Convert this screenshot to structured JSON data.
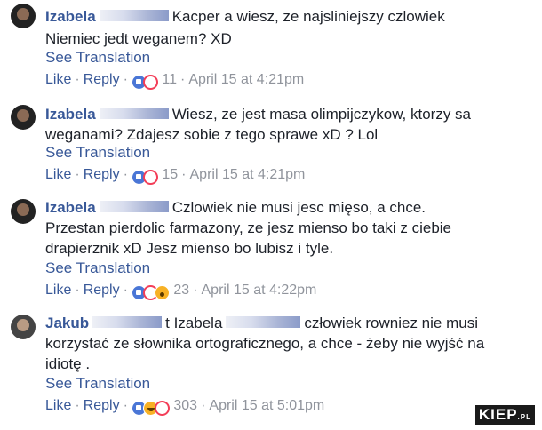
{
  "comments": [
    {
      "author": "Izabela",
      "lines": [
        "Kacper a wiesz, ze najsliniejszy czlowiek",
        "Niemiec jedt weganem? XD"
      ],
      "see_translation": "See Translation",
      "like": "Like",
      "reply": "Reply",
      "reaction_icons": [
        "like-icon",
        "love-icon"
      ],
      "reaction_count": "11",
      "timestamp": "April 15 at 4:21pm"
    },
    {
      "author": "Izabela",
      "lines": [
        "Wiesz, ze jest masa olimpijczykow, ktorzy sa",
        "weganami? Zdajesz sobie z tego sprawe xD ? Lol"
      ],
      "see_translation": "See Translation",
      "like": "Like",
      "reply": "Reply",
      "reaction_icons": [
        "like-icon",
        "love-icon"
      ],
      "reaction_count": "15",
      "timestamp": "April 15 at 4:21pm"
    },
    {
      "author": "Izabela",
      "lines": [
        "Czlowiek nie musi jesc mięso, a chce.",
        "Przestan pierdolic farmazony, ze jesz mienso bo taki z ciebie",
        "drapierznik xD Jesz mienso bo lubisz i tyle."
      ],
      "see_translation": "See Translation",
      "like": "Like",
      "reply": "Reply",
      "reaction_icons": [
        "like-icon",
        "love-icon",
        "wow-icon"
      ],
      "reaction_count": "23",
      "timestamp": "April 15 at 4:22pm"
    },
    {
      "author": "Jakub",
      "mention": "t Izabela",
      "lines": [
        "człowiek rowniez nie musi",
        "korzystać ze słownika ortograficznego, a chce - żeby nie wyjść na",
        "idiotę ."
      ],
      "see_translation": "See Translation",
      "like": "Like",
      "reply": "Reply",
      "reaction_icons": [
        "like-icon",
        "haha-icon",
        "love-icon"
      ],
      "reaction_count": "303",
      "timestamp": "April 15 at 5:01pm"
    }
  ],
  "watermark": {
    "main": "KIEP",
    "suffix": ".PL"
  }
}
